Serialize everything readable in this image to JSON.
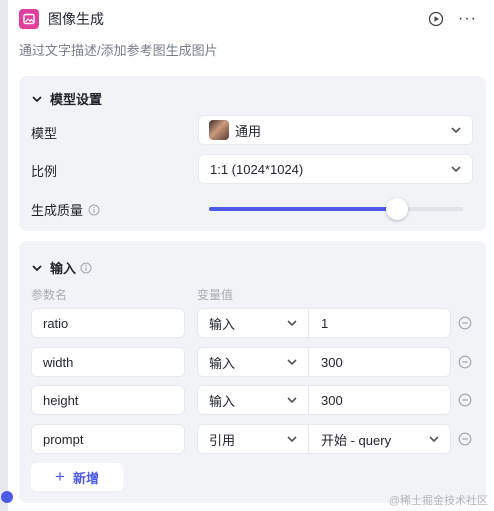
{
  "header": {
    "title": "图像生成",
    "icon": "image-generate-icon",
    "more": "···"
  },
  "description": "通过文字描述/添加参考图生成图片",
  "model_settings": {
    "title": "模型设置",
    "model_label": "模型",
    "model_value": "通用",
    "ratio_label": "比例",
    "ratio_value": "1:1 (1024*1024)",
    "quality_label": "生成质量",
    "quality_level": 0.74
  },
  "inputs": {
    "title": "输入",
    "col_name": "参数名",
    "col_value": "变量值",
    "rows": [
      {
        "name": "ratio",
        "type": "输入",
        "value": "1"
      },
      {
        "name": "width",
        "type": "输入",
        "value": "300"
      },
      {
        "name": "height",
        "type": "输入",
        "value": "300"
      },
      {
        "name": "prompt",
        "type": "引用",
        "value": "开始 - query"
      }
    ],
    "add_label": "新增"
  },
  "watermark": "@稀土掘金技术社区",
  "colors": {
    "accent": "#4e5ae8",
    "node_icon": "#e0409c",
    "card_bg": "#f2f3f7"
  }
}
